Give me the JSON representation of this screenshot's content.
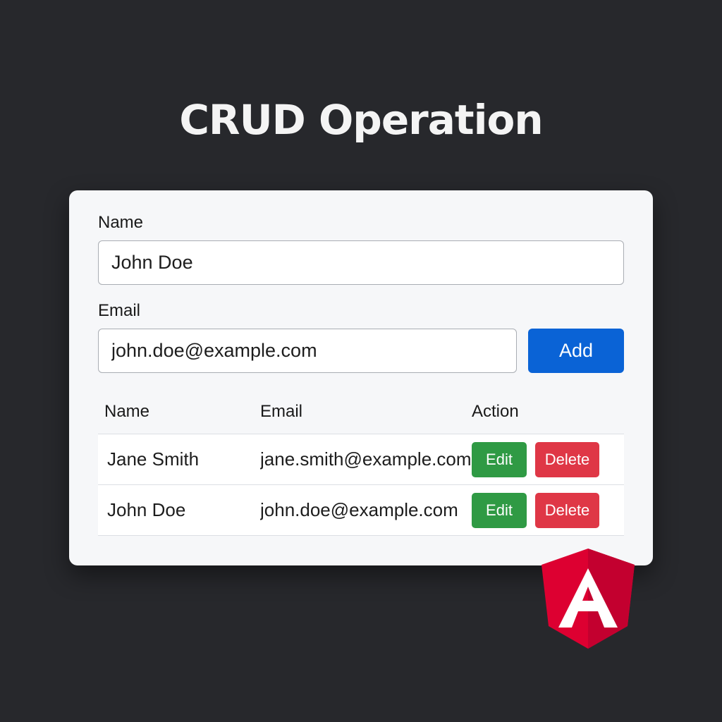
{
  "page": {
    "title": "CRUD Operation"
  },
  "form": {
    "name_label": "Name",
    "name_value": "John Doe",
    "email_label": "Email",
    "email_value": "john.doe@example.com",
    "add_label": "Add"
  },
  "table": {
    "headers": [
      "Name",
      "Email",
      "Action"
    ],
    "rows": [
      {
        "name": "Jane Smith",
        "email": "jane.smith@example.com",
        "edit_label": "Edit",
        "delete_label": "Delete"
      },
      {
        "name": "John Doe",
        "email": "john.doe@example.com",
        "edit_label": "Edit",
        "delete_label": "Delete"
      }
    ]
  },
  "logo": {
    "icon": "angular-logo-icon",
    "letter": "A"
  },
  "colors": {
    "background": "#27282c",
    "card": "#f6f7f9",
    "primary": "#0a63d6",
    "success": "#2f9a44",
    "danger": "#df3746",
    "angular": "#dd0031"
  }
}
